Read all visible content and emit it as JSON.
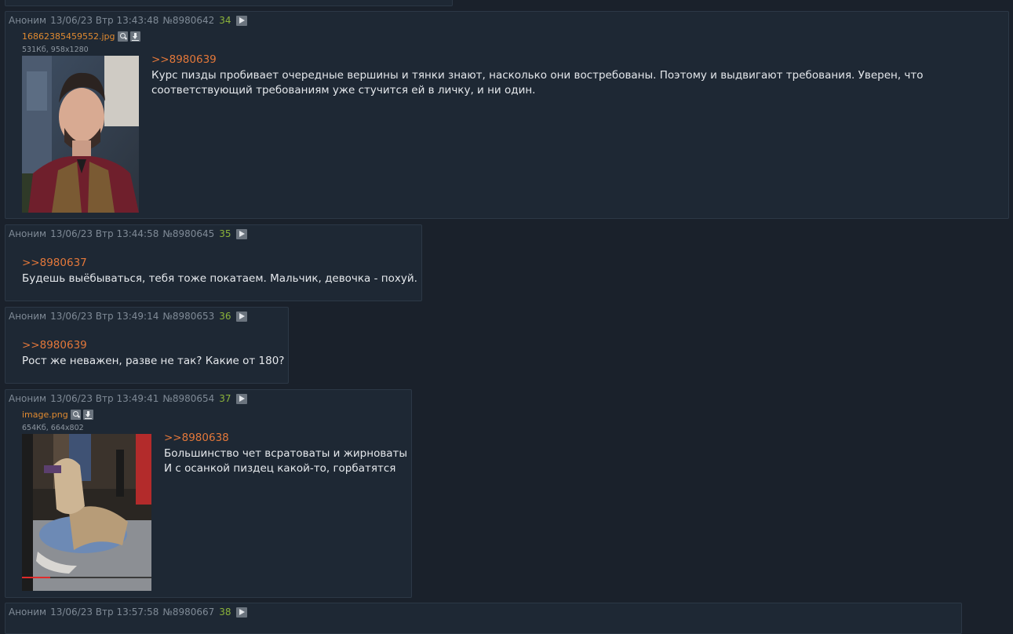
{
  "posts": [
    {
      "author": "Аноним",
      "date": "13/06/23 Втр 13:43:48",
      "num": "№8980642",
      "count": "34",
      "file": {
        "name": "16862385459552.jpg",
        "meta": "531Кб, 958x1280"
      },
      "reply_to": ">>8980639",
      "lines": [
        "Курс пизды пробивает очередные вершины и тянки знают, насколько они востребованы. Поэтому и выдвигают требования. Уверен, что",
        "соответствующий требованиям уже стучится ей в личку, и ни один."
      ]
    },
    {
      "author": "Аноним",
      "date": "13/06/23 Втр 13:44:58",
      "num": "№8980645",
      "count": "35",
      "reply_to": ">>8980637",
      "lines": [
        "Будешь выёбываться, тебя тоже покатаем. Мальчик, девочка - похуй."
      ]
    },
    {
      "author": "Аноним",
      "date": "13/06/23 Втр 13:49:14",
      "num": "№8980653",
      "count": "36",
      "reply_to": ">>8980639",
      "lines": [
        "Рост же неважен, разве не так? Какие от 180?"
      ]
    },
    {
      "author": "Аноним",
      "date": "13/06/23 Втр 13:49:41",
      "num": "№8980654",
      "count": "37",
      "file": {
        "name": "image.png",
        "meta": "654Кб, 664x802"
      },
      "reply_to": ">>8980638",
      "lines": [
        "Большинство чет всратоваты и жирноваты",
        "И с осанкой пиздец какой-то, горбатятся"
      ]
    },
    {
      "author": "Аноним",
      "date": "13/06/23 Втр 13:57:58",
      "num": "№8980667",
      "count": "38"
    }
  ],
  "colors": {
    "background": "#1a212b",
    "post_bg": "#1e2834",
    "reply_link": "#e4783a",
    "filename": "#e08a30",
    "count": "#8bb33a"
  }
}
